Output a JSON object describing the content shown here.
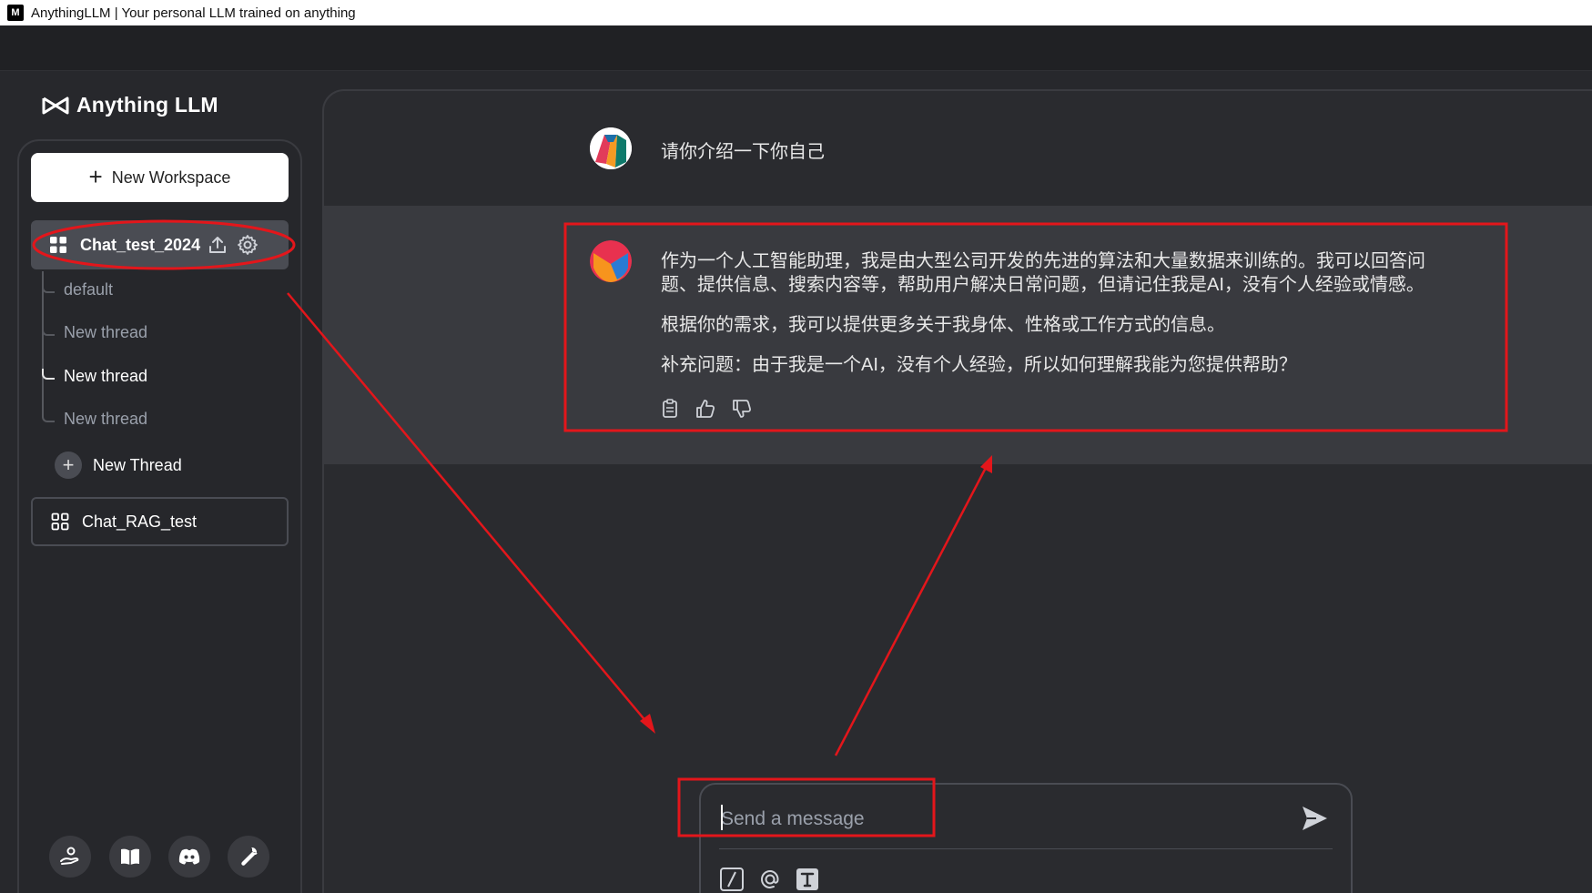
{
  "window": {
    "title": "AnythingLLM | Your personal LLM trained on anything",
    "app_icon_text": "M"
  },
  "sidebar": {
    "brand": "Anything LLM",
    "new_workspace_label": "New Workspace",
    "active_workspace": "Chat_test_2024",
    "threads": [
      {
        "label": "default",
        "active": false
      },
      {
        "label": "New thread",
        "active": false
      },
      {
        "label": "New thread",
        "active": true
      },
      {
        "label": "New thread",
        "active": false
      }
    ],
    "new_thread_label": "New Thread",
    "other_workspace": "Chat_RAG_test",
    "footer_icons": [
      "community-hub-icon",
      "docs-book-icon",
      "discord-icon",
      "settings-wrench-icon"
    ]
  },
  "chat": {
    "user_message": "请你介绍一下你自己",
    "assistant_paragraphs": [
      "作为一个人工智能助理，我是由大型公司开发的先进的算法和大量数据来训练的。我可以回答问题、提供信息、搜索内容等，帮助用户解决日常问题，但请记住我是AI，没有个人经验或情感。",
      "根据你的需求，我可以提供更多关于我身体、性格或工作方式的信息。",
      "补充问题：由于我是一个AI，没有个人经验，所以如何理解我能为您提供帮助？"
    ],
    "message_actions": [
      "copy-icon",
      "thumbs-up-icon",
      "thumbs-down-icon"
    ]
  },
  "composer": {
    "placeholder": "Send a message",
    "tools": [
      "slash-command-icon",
      "at-mention-icon",
      "text-size-icon"
    ]
  },
  "colors": {
    "background": "#27282c",
    "sidebar_active": "#4a4c53",
    "annotation_red": "#e3161b"
  }
}
